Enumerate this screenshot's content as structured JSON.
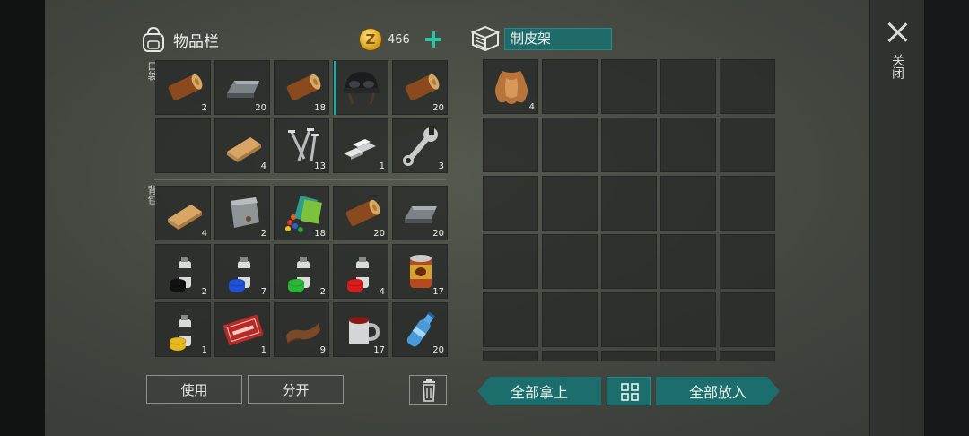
{
  "inventory": {
    "title": "物品栏",
    "coins": "466",
    "coin_symbol": "Z",
    "pocket_label": "口袋",
    "backpack_label": "背包",
    "pocket_slots": [
      {
        "item": "log-icon",
        "qty": "2"
      },
      {
        "item": "iron-ingot-icon",
        "qty": "20"
      },
      {
        "item": "log-icon",
        "qty": "18"
      },
      {
        "item": "helmet-icon",
        "qty": ""
      },
      {
        "item": "log-icon",
        "qty": "20"
      },
      {
        "item": "empty",
        "qty": ""
      },
      {
        "item": "plank-icon",
        "qty": "4"
      },
      {
        "item": "nails-icon",
        "qty": "13"
      },
      {
        "item": "metal-bars-icon",
        "qty": "1"
      },
      {
        "item": "wrench-icon",
        "qty": "3"
      }
    ],
    "backpack_slots": [
      {
        "item": "plank-icon",
        "qty": "4"
      },
      {
        "item": "metal-plate-icon",
        "qty": "2"
      },
      {
        "item": "gum-pack-icon",
        "qty": "18"
      },
      {
        "item": "log-icon",
        "qty": "20"
      },
      {
        "item": "iron-ingot-icon",
        "qty": "20"
      },
      {
        "item": "spray-paint-black-icon",
        "qty": "2"
      },
      {
        "item": "spray-paint-blue-icon",
        "qty": "7"
      },
      {
        "item": "spray-paint-green-icon",
        "qty": "2"
      },
      {
        "item": "spray-paint-red-icon",
        "qty": "4"
      },
      {
        "item": "canned-food-icon",
        "qty": "17"
      },
      {
        "item": "spray-paint-yellow-icon",
        "qty": "1"
      },
      {
        "item": "coupon-icon",
        "qty": "1"
      },
      {
        "item": "leather-icon",
        "qty": "9"
      },
      {
        "item": "mug-icon",
        "qty": "17"
      },
      {
        "item": "water-bottle-icon",
        "qty": "20"
      }
    ],
    "use_button": "使用",
    "split_button": "分开"
  },
  "crafting": {
    "title": "制皮架",
    "slots": [
      {
        "item": "hide-icon",
        "qty": "4"
      }
    ],
    "take_all_button": "全部拿上",
    "put_all_button": "全部放入"
  },
  "close_label": "关闭",
  "colors": {
    "accent": "#1c6e6c",
    "accent_light": "#2ec4a3",
    "coin": "#d19a1c"
  }
}
